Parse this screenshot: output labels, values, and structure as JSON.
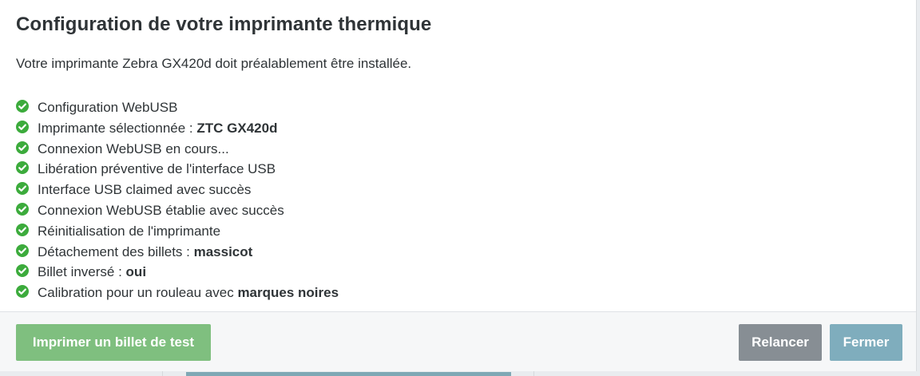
{
  "modal": {
    "title": "Configuration de votre imprimante thermique",
    "intro": "Votre imprimante Zebra GX420d doit préalablement être installée.",
    "status_color": "#3cab3c",
    "check_icon": "check-circle-icon",
    "steps": [
      {
        "label": "Configuration WebUSB",
        "value": ""
      },
      {
        "label": "Imprimante sélectionnée : ",
        "value": "ZTC GX420d"
      },
      {
        "label": "Connexion WebUSB en cours...",
        "value": ""
      },
      {
        "label": "Libération préventive de l'interface USB",
        "value": ""
      },
      {
        "label": "Interface USB claimed avec succès",
        "value": ""
      },
      {
        "label": "Connexion WebUSB établie avec succès",
        "value": ""
      },
      {
        "label": "Réinitialisation de l'imprimante",
        "value": ""
      },
      {
        "label": "Détachement des billets : ",
        "value": "massicot"
      },
      {
        "label": "Billet inversé : ",
        "value": "oui"
      },
      {
        "label": "Calibration pour un rouleau avec ",
        "value": "marques noires"
      }
    ]
  },
  "footer": {
    "print_test_label": "Imprimer un billet de test",
    "retry_label": "Relancer",
    "close_label": "Fermer",
    "colors": {
      "print_test": "#7fbf7f",
      "retry": "#878e94",
      "close": "#7fadbd"
    }
  }
}
